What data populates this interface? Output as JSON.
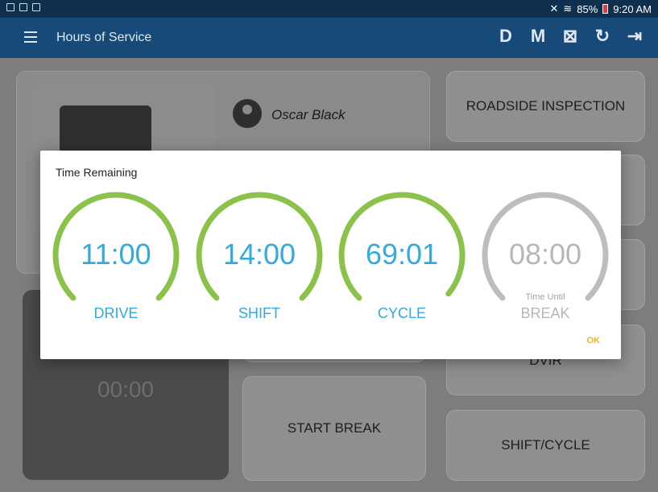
{
  "status": {
    "right_text": "85%",
    "time": "9:20 AM"
  },
  "appbar": {
    "title": "Hours of Service",
    "actions": [
      "D",
      "M",
      "⊠",
      "↻",
      "⇥"
    ]
  },
  "dashboard": {
    "driver_name": "Oscar Black",
    "timer": "00:00",
    "buttons": {
      "roadside": "ROADSIDE INSPECTION",
      "dvir": "DVIR",
      "start_break": "START BREAK",
      "shift_cycle": "SHIFT/CYCLE"
    }
  },
  "dialog": {
    "title": "Time Remaining",
    "ok": "OK",
    "gauges": [
      {
        "value": "11:00",
        "label": "DRIVE",
        "sub": "",
        "fill": 1.0,
        "color": "#8bc34a"
      },
      {
        "value": "14:00",
        "label": "SHIFT",
        "sub": "",
        "fill": 1.0,
        "color": "#8bc34a"
      },
      {
        "value": "69:01",
        "label": "CYCLE",
        "sub": "",
        "fill": 0.98,
        "color": "#8bc34a"
      },
      {
        "value": "08:00",
        "label": "BREAK",
        "sub": "Time Until",
        "fill": 1.0,
        "color": "#bdbdbd"
      }
    ]
  },
  "colors": {
    "accent": "#33a9df",
    "green": "#8bc34a",
    "grey": "#bdbdbd",
    "appbar": "#174a78"
  }
}
